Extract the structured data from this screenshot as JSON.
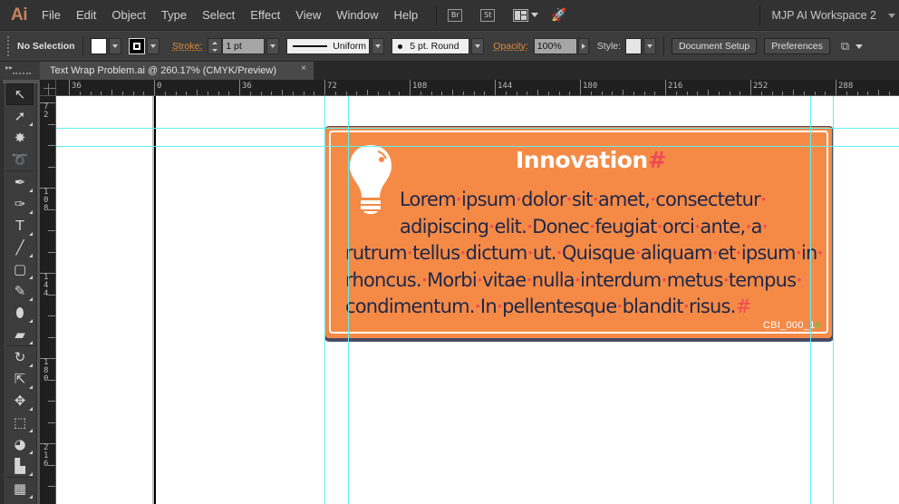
{
  "app": {
    "logo": "Ai",
    "menu": [
      {
        "label": "File",
        "mnemonic": "F"
      },
      {
        "label": "Edit",
        "mnemonic": "E"
      },
      {
        "label": "Object",
        "mnemonic": "O"
      },
      {
        "label": "Type",
        "mnemonic": "T"
      },
      {
        "label": "Select",
        "mnemonic": "S"
      },
      {
        "label": "Effect",
        "mnemonic": "c"
      },
      {
        "label": "View",
        "mnemonic": "V"
      },
      {
        "label": "Window",
        "mnemonic": "W"
      },
      {
        "label": "Help",
        "mnemonic": "H"
      }
    ],
    "bridge_label": "Br",
    "stock_label": "St",
    "workspace": "MJP AI Workspace 2"
  },
  "control_bar": {
    "selection": "No Selection",
    "fill_color": "#ffffff",
    "stroke_label": "Stroke:",
    "stroke_weight": "1 pt",
    "profile": "Uniform",
    "brush": "5 pt. Round",
    "opacity_label": "Opacity:",
    "opacity": "100%",
    "style_label": "Style:",
    "document_setup": "Document Setup",
    "preferences": "Preferences"
  },
  "document": {
    "tab_title": "Text Wrap Problem.ai @ 260.17% (CMYK/Preview)",
    "close_glyph": "×",
    "zoom": "260.17%",
    "color_mode": "CMYK/Preview"
  },
  "rulers": {
    "horizontal": [
      "36",
      "0",
      "36",
      "72",
      "108",
      "144",
      "180",
      "216",
      "252",
      "288"
    ],
    "vertical": [
      "72",
      "108",
      "144",
      "180",
      "216"
    ]
  },
  "tools": [
    {
      "name": "selection-tool",
      "glyph": "↖"
    },
    {
      "name": "direct-selection-tool",
      "glyph": "➚"
    },
    {
      "name": "magic-wand-tool",
      "glyph": "✸"
    },
    {
      "name": "lasso-tool",
      "glyph": "➰"
    },
    {
      "name": "pen-tool",
      "glyph": "✒"
    },
    {
      "name": "curvature-tool",
      "glyph": "✑"
    },
    {
      "name": "type-tool",
      "glyph": "T"
    },
    {
      "name": "line-tool",
      "glyph": "╱"
    },
    {
      "name": "rectangle-tool",
      "glyph": "▢"
    },
    {
      "name": "paintbrush-tool",
      "glyph": "✎"
    },
    {
      "name": "blob-brush-tool",
      "glyph": "⬮"
    },
    {
      "name": "eraser-tool",
      "glyph": "▰"
    },
    {
      "name": "rotate-tool",
      "glyph": "↻"
    },
    {
      "name": "scale-tool",
      "glyph": "⇱"
    },
    {
      "name": "puppet-warp-tool",
      "glyph": "✥"
    },
    {
      "name": "free-transform-tool",
      "glyph": "⬚"
    },
    {
      "name": "shape-builder-tool",
      "glyph": "◕"
    },
    {
      "name": "graph-tool",
      "glyph": "▙"
    },
    {
      "name": "mesh-tool",
      "glyph": "▦"
    }
  ],
  "artwork": {
    "bg_color": "#f58a47",
    "title": "Innovation",
    "end_mark": "#",
    "body_lines": [
      "Lorem ipsum dolor sit amet, consectetur",
      "adipiscing elit. Donec feugiat orci ante, a",
      "rutrum tellus dictum ut. Quisque aliquam et ipsum in",
      "rhoncus. Morbi vitae nulla interdum metus tempus",
      "condimentum. In pellentesque blandit risus."
    ],
    "code": "CBI_000_1"
  }
}
